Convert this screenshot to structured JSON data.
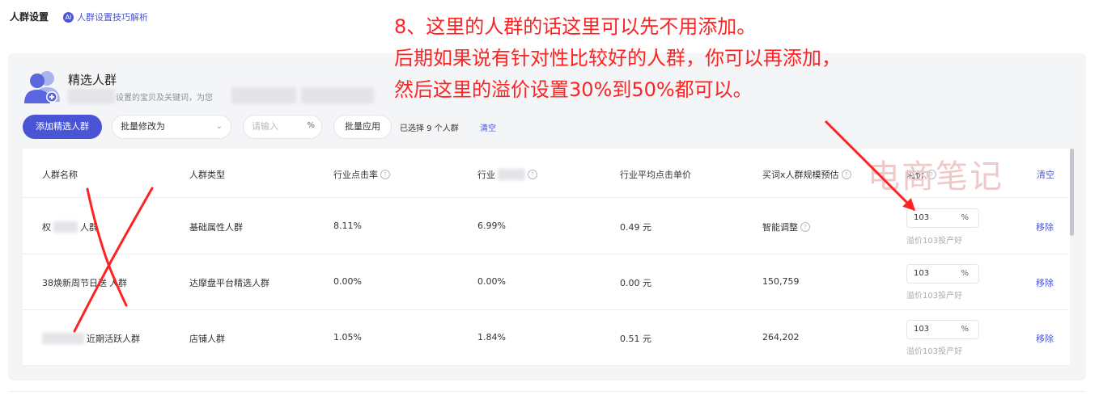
{
  "header": {
    "title": "人群设置",
    "tip_icon": "AI",
    "tip_label": "人群设置技巧解析"
  },
  "section": {
    "title": "精选人群",
    "desc_part1": "设置的宝贝及关键词，为您"
  },
  "toolbar": {
    "add_label": "添加精选人群",
    "bulk_select_value": "批量修改为",
    "input_placeholder": "请输入",
    "unit": "%",
    "apply_label": "批量应用",
    "selected_text": "已选择 9 个人群",
    "clear_label": "清空"
  },
  "table": {
    "columns": [
      "人群名称",
      "人群类型",
      "行业点击率",
      "行业",
      "行业平均点击单价",
      "买词x人群规模预估",
      "溢价",
      "清空"
    ],
    "rows": [
      {
        "name_a": "权",
        "name_b": "人群",
        "type": "基础属性人群",
        "ctr": "8.11%",
        "industry": "6.99%",
        "cpc": "0.49 元",
        "scale": "智能调整",
        "premium": "103",
        "unit": "%",
        "hint": "溢价103投产好",
        "action": "移除"
      },
      {
        "name_a": "38焕新周节日送",
        "name_b": "人群",
        "type": "达摩盘平台精选人群",
        "ctr": "0.00%",
        "industry": "0.00%",
        "cpc": "0.00 元",
        "scale": "150,759",
        "premium": "103",
        "unit": "%",
        "hint": "溢价103投产好",
        "action": "移除"
      },
      {
        "name_a": "",
        "name_b": "近期活跃人群",
        "type": "店铺人群",
        "ctr": "1.05%",
        "industry": "1.84%",
        "cpc": "0.51 元",
        "scale": "264,202",
        "premium": "103",
        "unit": "%",
        "hint": "溢价103投产好",
        "action": "移除"
      }
    ]
  },
  "annotation": {
    "line1": "8、这里的人群的话这里可以先不用添加。",
    "line2": "后期如果说有针对性比较好的人群，你可以再添加，",
    "line3": "然后这里的溢价设置30%到50%都可以。",
    "color": "#ff2222"
  },
  "watermark": "电商笔记",
  "colors": {
    "accent": "#4a55d6",
    "annotation": "#ff2222"
  }
}
